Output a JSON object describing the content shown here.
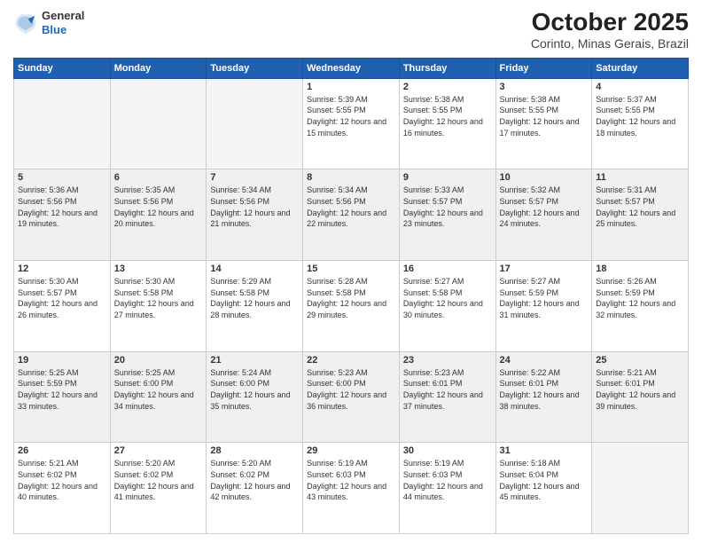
{
  "header": {
    "logo": {
      "general": "General",
      "blue": "Blue"
    },
    "title": "October 2025",
    "location": "Corinto, Minas Gerais, Brazil"
  },
  "calendar": {
    "days_of_week": [
      "Sunday",
      "Monday",
      "Tuesday",
      "Wednesday",
      "Thursday",
      "Friday",
      "Saturday"
    ],
    "rows": [
      {
        "cells": [
          {
            "day": "",
            "empty": true
          },
          {
            "day": "",
            "empty": true
          },
          {
            "day": "",
            "empty": true
          },
          {
            "day": "1",
            "sunrise": "Sunrise: 5:39 AM",
            "sunset": "Sunset: 5:55 PM",
            "daylight": "Daylight: 12 hours and 15 minutes."
          },
          {
            "day": "2",
            "sunrise": "Sunrise: 5:38 AM",
            "sunset": "Sunset: 5:55 PM",
            "daylight": "Daylight: 12 hours and 16 minutes."
          },
          {
            "day": "3",
            "sunrise": "Sunrise: 5:38 AM",
            "sunset": "Sunset: 5:55 PM",
            "daylight": "Daylight: 12 hours and 17 minutes."
          },
          {
            "day": "4",
            "sunrise": "Sunrise: 5:37 AM",
            "sunset": "Sunset: 5:55 PM",
            "daylight": "Daylight: 12 hours and 18 minutes."
          }
        ]
      },
      {
        "cells": [
          {
            "day": "5",
            "sunrise": "Sunrise: 5:36 AM",
            "sunset": "Sunset: 5:56 PM",
            "daylight": "Daylight: 12 hours and 19 minutes."
          },
          {
            "day": "6",
            "sunrise": "Sunrise: 5:35 AM",
            "sunset": "Sunset: 5:56 PM",
            "daylight": "Daylight: 12 hours and 20 minutes."
          },
          {
            "day": "7",
            "sunrise": "Sunrise: 5:34 AM",
            "sunset": "Sunset: 5:56 PM",
            "daylight": "Daylight: 12 hours and 21 minutes."
          },
          {
            "day": "8",
            "sunrise": "Sunrise: 5:34 AM",
            "sunset": "Sunset: 5:56 PM",
            "daylight": "Daylight: 12 hours and 22 minutes."
          },
          {
            "day": "9",
            "sunrise": "Sunrise: 5:33 AM",
            "sunset": "Sunset: 5:57 PM",
            "daylight": "Daylight: 12 hours and 23 minutes."
          },
          {
            "day": "10",
            "sunrise": "Sunrise: 5:32 AM",
            "sunset": "Sunset: 5:57 PM",
            "daylight": "Daylight: 12 hours and 24 minutes."
          },
          {
            "day": "11",
            "sunrise": "Sunrise: 5:31 AM",
            "sunset": "Sunset: 5:57 PM",
            "daylight": "Daylight: 12 hours and 25 minutes."
          }
        ]
      },
      {
        "cells": [
          {
            "day": "12",
            "sunrise": "Sunrise: 5:30 AM",
            "sunset": "Sunset: 5:57 PM",
            "daylight": "Daylight: 12 hours and 26 minutes."
          },
          {
            "day": "13",
            "sunrise": "Sunrise: 5:30 AM",
            "sunset": "Sunset: 5:58 PM",
            "daylight": "Daylight: 12 hours and 27 minutes."
          },
          {
            "day": "14",
            "sunrise": "Sunrise: 5:29 AM",
            "sunset": "Sunset: 5:58 PM",
            "daylight": "Daylight: 12 hours and 28 minutes."
          },
          {
            "day": "15",
            "sunrise": "Sunrise: 5:28 AM",
            "sunset": "Sunset: 5:58 PM",
            "daylight": "Daylight: 12 hours and 29 minutes."
          },
          {
            "day": "16",
            "sunrise": "Sunrise: 5:27 AM",
            "sunset": "Sunset: 5:58 PM",
            "daylight": "Daylight: 12 hours and 30 minutes."
          },
          {
            "day": "17",
            "sunrise": "Sunrise: 5:27 AM",
            "sunset": "Sunset: 5:59 PM",
            "daylight": "Daylight: 12 hours and 31 minutes."
          },
          {
            "day": "18",
            "sunrise": "Sunrise: 5:26 AM",
            "sunset": "Sunset: 5:59 PM",
            "daylight": "Daylight: 12 hours and 32 minutes."
          }
        ]
      },
      {
        "cells": [
          {
            "day": "19",
            "sunrise": "Sunrise: 5:25 AM",
            "sunset": "Sunset: 5:59 PM",
            "daylight": "Daylight: 12 hours and 33 minutes."
          },
          {
            "day": "20",
            "sunrise": "Sunrise: 5:25 AM",
            "sunset": "Sunset: 6:00 PM",
            "daylight": "Daylight: 12 hours and 34 minutes."
          },
          {
            "day": "21",
            "sunrise": "Sunrise: 5:24 AM",
            "sunset": "Sunset: 6:00 PM",
            "daylight": "Daylight: 12 hours and 35 minutes."
          },
          {
            "day": "22",
            "sunrise": "Sunrise: 5:23 AM",
            "sunset": "Sunset: 6:00 PM",
            "daylight": "Daylight: 12 hours and 36 minutes."
          },
          {
            "day": "23",
            "sunrise": "Sunrise: 5:23 AM",
            "sunset": "Sunset: 6:01 PM",
            "daylight": "Daylight: 12 hours and 37 minutes."
          },
          {
            "day": "24",
            "sunrise": "Sunrise: 5:22 AM",
            "sunset": "Sunset: 6:01 PM",
            "daylight": "Daylight: 12 hours and 38 minutes."
          },
          {
            "day": "25",
            "sunrise": "Sunrise: 5:21 AM",
            "sunset": "Sunset: 6:01 PM",
            "daylight": "Daylight: 12 hours and 39 minutes."
          }
        ]
      },
      {
        "cells": [
          {
            "day": "26",
            "sunrise": "Sunrise: 5:21 AM",
            "sunset": "Sunset: 6:02 PM",
            "daylight": "Daylight: 12 hours and 40 minutes."
          },
          {
            "day": "27",
            "sunrise": "Sunrise: 5:20 AM",
            "sunset": "Sunset: 6:02 PM",
            "daylight": "Daylight: 12 hours and 41 minutes."
          },
          {
            "day": "28",
            "sunrise": "Sunrise: 5:20 AM",
            "sunset": "Sunset: 6:02 PM",
            "daylight": "Daylight: 12 hours and 42 minutes."
          },
          {
            "day": "29",
            "sunrise": "Sunrise: 5:19 AM",
            "sunset": "Sunset: 6:03 PM",
            "daylight": "Daylight: 12 hours and 43 minutes."
          },
          {
            "day": "30",
            "sunrise": "Sunrise: 5:19 AM",
            "sunset": "Sunset: 6:03 PM",
            "daylight": "Daylight: 12 hours and 44 minutes."
          },
          {
            "day": "31",
            "sunrise": "Sunrise: 5:18 AM",
            "sunset": "Sunset: 6:04 PM",
            "daylight": "Daylight: 12 hours and 45 minutes."
          },
          {
            "day": "",
            "empty": true
          }
        ]
      }
    ]
  }
}
